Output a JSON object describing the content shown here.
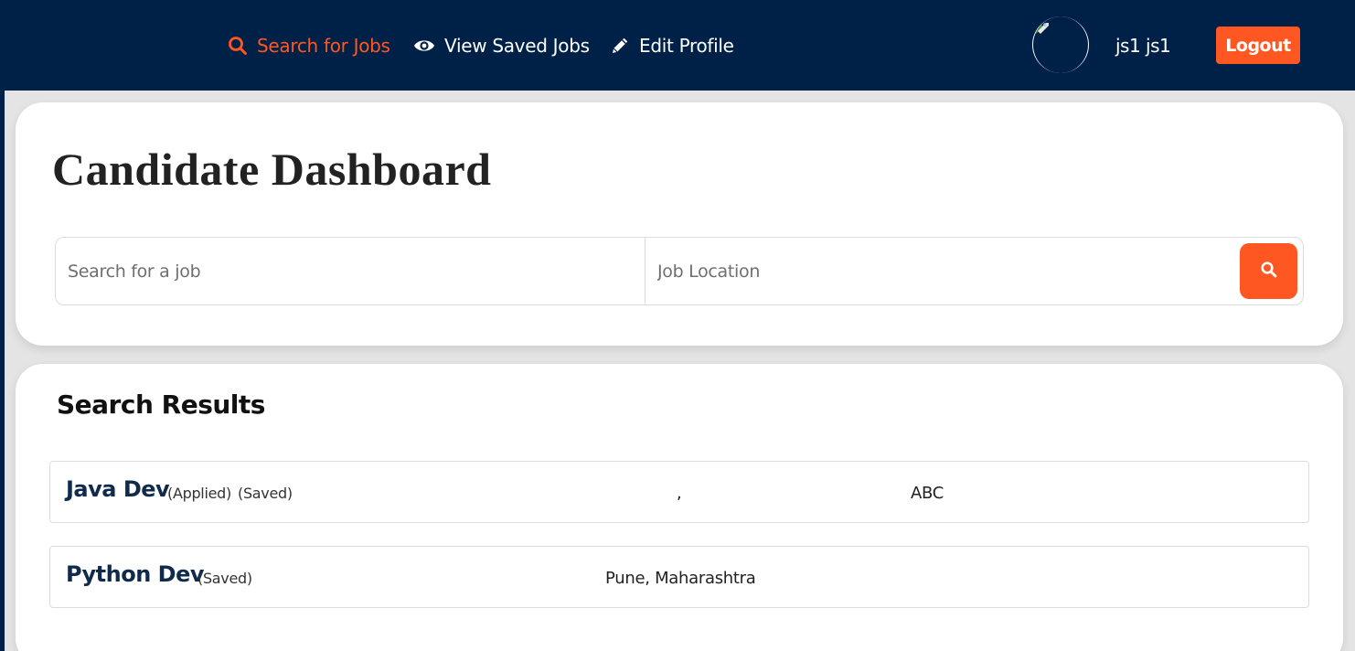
{
  "nav": {
    "search_jobs": "Search for Jobs",
    "view_saved": "View Saved Jobs",
    "edit_profile": "Edit Profile",
    "username": "js1 js1",
    "logout": "Logout"
  },
  "dashboard": {
    "title": "Candidate Dashboard",
    "job_placeholder": "Search for a job",
    "location_placeholder": "Job Location"
  },
  "results": {
    "title": "Search Results",
    "items": [
      {
        "title": "Java Dev",
        "tags": [
          "(Applied)",
          "(Saved)"
        ],
        "location": ",",
        "company": "ABC"
      },
      {
        "title": "Python Dev",
        "tags": [
          "(Saved)"
        ],
        "location": "Pune, Maharashtra",
        "company": ""
      }
    ]
  },
  "colors": {
    "navy": "#002147",
    "accent": "#ff5722"
  }
}
